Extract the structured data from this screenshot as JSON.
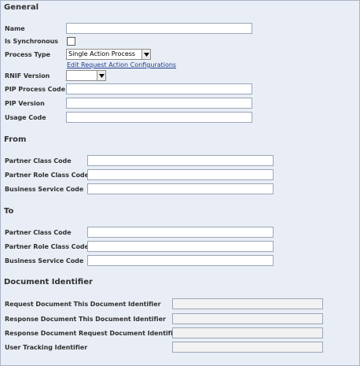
{
  "general": {
    "heading": "General",
    "name_label": "Name",
    "is_sync_label": "Is Synchronous",
    "process_type_label": "Process Type",
    "process_type_value": "Single Action Process",
    "edit_link": "Edit Request Action Configurations",
    "rnif_label": "RNIF Version",
    "rnif_value": "",
    "pip_process_code_label": "PIP Process Code",
    "pip_version_label": "PIP Version",
    "usage_code_label": "Usage Code"
  },
  "from": {
    "heading": "From",
    "partner_class_label": "Partner Class Code",
    "partner_role_label": "Partner Role Class Code",
    "business_service_label": "Business Service Code"
  },
  "to": {
    "heading": "To",
    "partner_class_label": "Partner Class Code",
    "partner_role_label": "Partner Role Class Code",
    "business_service_label": "Business Service Code"
  },
  "doc": {
    "heading": "Document Identifier",
    "req_this_label": "Request Document This Document Identifier",
    "resp_this_label": "Response Document This Document Identifier",
    "resp_req_label": "Response Document Request Document Identifier",
    "user_tracking_label": "User Tracking Identifier"
  },
  "icons": {
    "dropdown_arrow": "chevron-down-icon"
  }
}
